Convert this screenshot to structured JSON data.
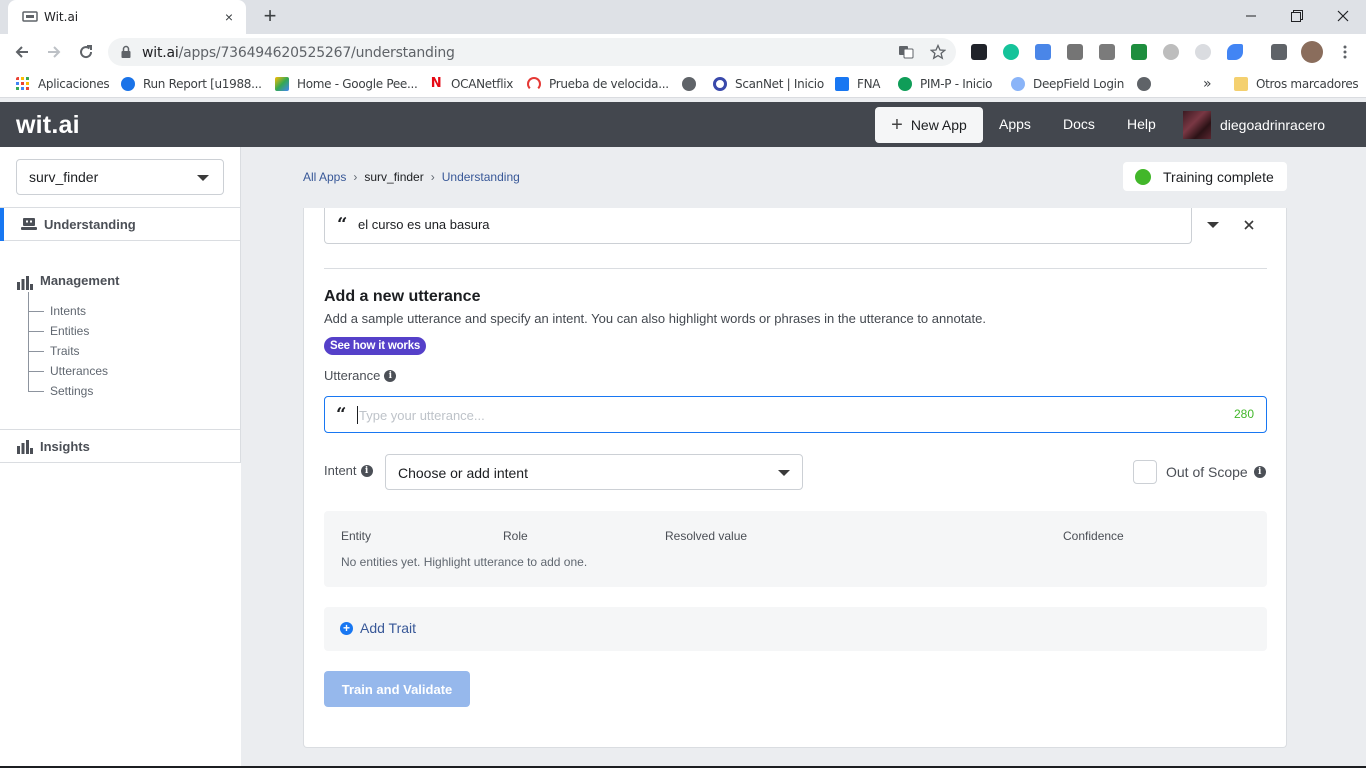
{
  "browser": {
    "tab_title": "Wit.ai",
    "tab_close": "×",
    "new_tab": "+",
    "url_host": "wit.ai",
    "url_path": "/apps/736494620525267/understanding",
    "bookmarks": [
      {
        "label": "Aplicaciones",
        "color": "#ea4335"
      },
      {
        "label": "Run Report [u1988...",
        "color": "#1a73e8"
      },
      {
        "label": "Home - Google Pee...",
        "color": "#34a853"
      },
      {
        "label": "OCANetflix",
        "color": "#e50914"
      },
      {
        "label": "Prueba de velocida...",
        "color": "#e53935"
      },
      {
        "label": "",
        "color": "#5f6368"
      },
      {
        "label": "ScanNet | Inicio",
        "color": "#3949ab"
      },
      {
        "label": "FNA",
        "color": "#1877f2"
      },
      {
        "label": "PIM-P - Inicio",
        "color": "#0f9d58"
      },
      {
        "label": "DeepField Login",
        "color": "#8ab4f8"
      },
      {
        "label": "",
        "color": "#5f6368"
      }
    ],
    "bookmarks_more": "»",
    "other_bookmarks": "Otros marcadores"
  },
  "header": {
    "logo": "wit.ai",
    "new_app": "New App",
    "nav": [
      "Apps",
      "Docs",
      "Help"
    ],
    "username": "diegoadrinracero"
  },
  "sidebar": {
    "app_name": "surv_finder",
    "understanding": "Understanding",
    "management": "Management",
    "management_items": [
      "Intents",
      "Entities",
      "Traits",
      "Utterances",
      "Settings"
    ],
    "insights": "Insights"
  },
  "breadcrumbs": [
    "All Apps",
    "surv_finder",
    "Understanding"
  ],
  "training_status": "Training complete",
  "previous_utterance": "el curso es una basura",
  "form": {
    "title": "Add a new utterance",
    "description": "Add a sample utterance and specify an intent. You can also highlight words or phrases in the utterance to annotate.",
    "how_it_works": "See how it works",
    "utterance_label": "Utterance",
    "utterance_value": "",
    "utterance_placeholder": "Type your utterance...",
    "char_counter": "280",
    "intent_label": "Intent",
    "intent_value": "Choose or add intent",
    "out_of_scope_label": "Out of Scope",
    "out_of_scope_checked": false,
    "entity_columns": [
      "Entity",
      "Role",
      "Resolved value",
      "Confidence"
    ],
    "entities_empty": "No entities yet. Highlight utterance to add one.",
    "add_trait": "Add Trait",
    "train_button": "Train and Validate"
  },
  "colors": {
    "header_bg": "#43474e",
    "accent": "#1877f2",
    "status_green": "#42b72a",
    "pill_purple": "#5540c9"
  }
}
